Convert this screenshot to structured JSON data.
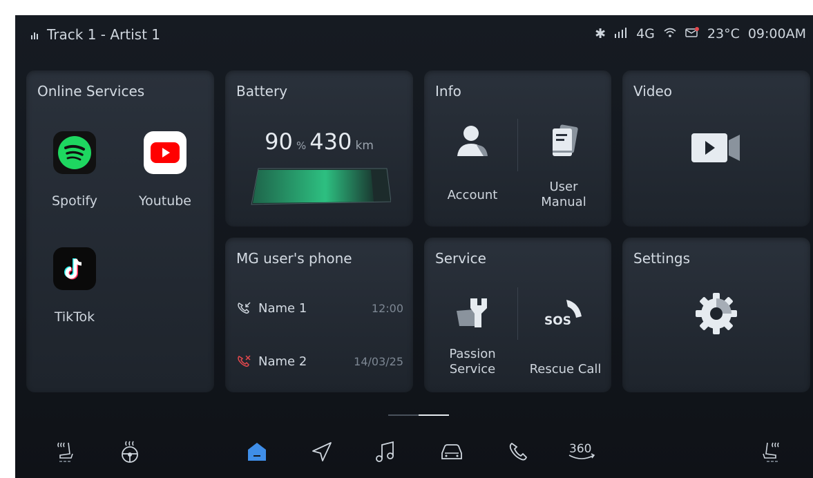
{
  "status_bar": {
    "track": "Track 1 - Artist 1",
    "network": "4G",
    "temperature": "23°C",
    "time": "09:00AM"
  },
  "online_services": {
    "title": "Online Services",
    "apps": [
      {
        "label": "Spotify",
        "icon": "spotify-icon"
      },
      {
        "label": "Youtube",
        "icon": "youtube-icon"
      },
      {
        "label": "TikTok",
        "icon": "tiktok-icon"
      }
    ]
  },
  "battery": {
    "title": "Battery",
    "percent": "90",
    "percent_unit": "%",
    "range": "430",
    "range_unit": "km",
    "level": 0.9
  },
  "info": {
    "title": "Info",
    "account_label": "Account",
    "manual_label": "User Manual"
  },
  "video": {
    "title": "Video"
  },
  "phone": {
    "title": "MG user's phone",
    "calls": [
      {
        "name": "Name 1",
        "time": "12:00",
        "type": "incoming"
      },
      {
        "name": "Name 2",
        "time": "14/03/25",
        "type": "missed"
      }
    ]
  },
  "service": {
    "title": "Service",
    "passion_label": "Passion Service",
    "rescue_label": "Rescue Call",
    "sos_text": "SOS"
  },
  "settings": {
    "title": "Settings"
  },
  "dock": {
    "items": [
      "seat-heat-left-icon",
      "steering-heat-icon",
      "home-icon",
      "navigation-icon",
      "music-icon",
      "car-icon",
      "phone-icon",
      "360-camera-icon",
      "seat-heat-right-icon"
    ],
    "cam_label": "360",
    "active": "home-icon"
  },
  "colors": {
    "accent": "#3f8ee8",
    "battery_green": "#2fd08a",
    "missed_red": "#e5484d",
    "spotify": "#1ed760",
    "youtube": "#ff0000"
  }
}
